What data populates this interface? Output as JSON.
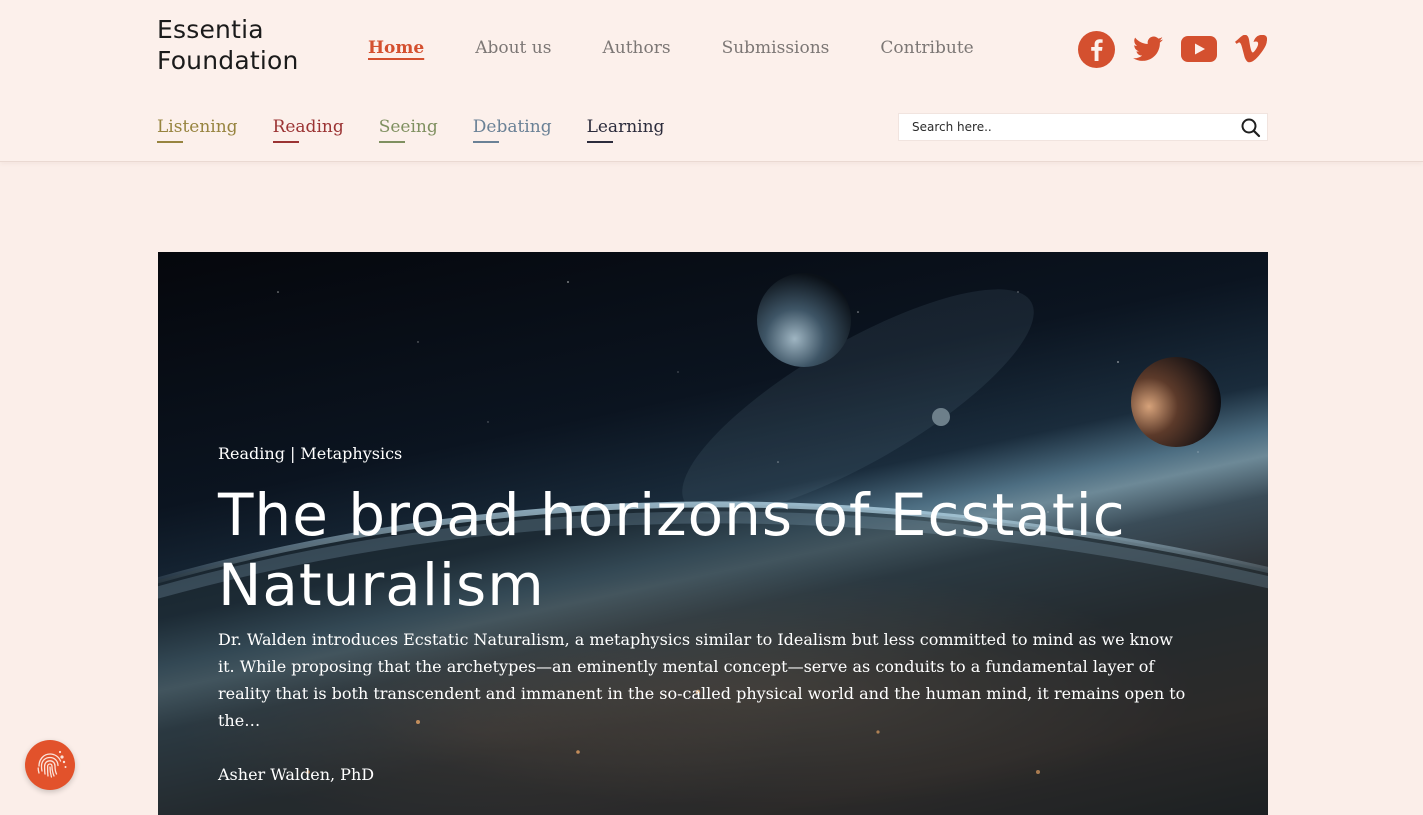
{
  "brand": {
    "logo_line1": "Essentia",
    "logo_line2": "Foundation",
    "accent_color": "#d4502f"
  },
  "main_nav": [
    {
      "label": "Home",
      "active": true
    },
    {
      "label": "About us"
    },
    {
      "label": "Authors"
    },
    {
      "label": "Submissions"
    },
    {
      "label": "Contribute"
    }
  ],
  "social": [
    {
      "icon": "facebook-icon"
    },
    {
      "icon": "twitter-icon"
    },
    {
      "icon": "youtube-icon"
    },
    {
      "icon": "vimeo-icon"
    }
  ],
  "sub_nav": [
    {
      "label": "Listening",
      "color": "#97843f"
    },
    {
      "label": "Reading",
      "color": "#9b3333"
    },
    {
      "label": "Seeing",
      "color": "#7f9060"
    },
    {
      "label": "Debating",
      "color": "#6a8196"
    },
    {
      "label": "Learning",
      "color": "#2c2c3c"
    }
  ],
  "search": {
    "placeholder": "Search here..",
    "icon": "search-icon"
  },
  "hero": {
    "category": "Reading",
    "separator": "|",
    "topic": "Metaphysics",
    "title": "The broad horizons of Ecstatic Naturalism",
    "excerpt": "Dr. Walden introduces Ecstatic Naturalism, a metaphysics similar to Idealism but less committed to mind as we know it. While proposing that the archetypes—an eminently mental concept—serve as conduits to a fundamental layer of reality that is both transcendent and immanent in the so-called physical world and the human mind, it remains open to the…",
    "author": "Asher Walden, PhD"
  },
  "fab": {
    "icon": "fingerprint-icon"
  }
}
